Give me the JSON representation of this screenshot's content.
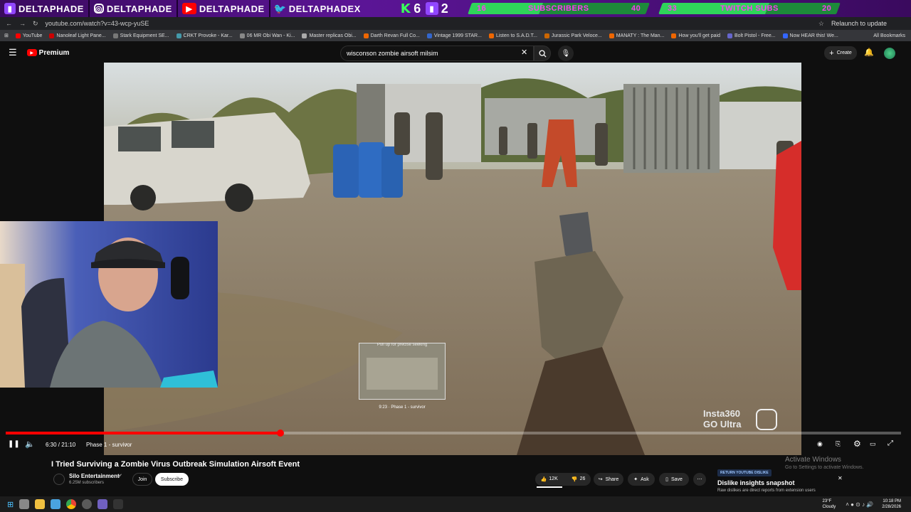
{
  "overlay": {
    "handles": [
      {
        "platform": "twitch",
        "name": "DELTAPHADE",
        "color": "#9146ff"
      },
      {
        "platform": "instagram",
        "name": "DELTAPHADE",
        "color": "#e1306c"
      },
      {
        "platform": "youtube",
        "name": "DELTAPHADE",
        "color": "#ff0000"
      },
      {
        "platform": "twitter",
        "name": "DELTAPHADEX",
        "color": "#1da1f2"
      }
    ],
    "counters": {
      "k_value": "6",
      "twitch_count": "2"
    },
    "subscribers": {
      "left": "16",
      "label": "SUBSCRIBERS",
      "right": "40",
      "progress": 0.4
    },
    "twitch_subs": {
      "left": "33",
      "label": "TWITCH SUBS",
      "right": "20",
      "progress": 0.6
    }
  },
  "browser": {
    "url": "youtube.com/watch?v=43-wcp-yuSE",
    "relaunch": "Relaunch to update",
    "all_bookmarks": "All Bookmarks",
    "bookmarks": [
      "YouTube",
      "Nanoleaf Light Pane...",
      "Stark Equipment SE...",
      "CRKT Provoke - Kar...",
      "06 MR Obi Wan - Ki...",
      "Master replicas Obi...",
      "Darth Revan Full Co...",
      "Vintage 1999 STAR...",
      "Listen to S.A.D.T...",
      "Jurassic Park Veloce...",
      "MANATY : The Man...",
      "How you'll get paid",
      "Bolt Pistol - Free...",
      "Now HEAR this! We..."
    ]
  },
  "youtube": {
    "logo": "Premium",
    "search_value": "wisconson zombie airsoft milsim",
    "create_label": "Create"
  },
  "player": {
    "time": "6:30 / 21:10",
    "chapter": "Phase 1 - survivor",
    "preview_hint": "Pull up for precise seeking",
    "preview_time": "9:23 · Phase 1 - survivor",
    "watermark_top": "Insta360",
    "watermark_bottom": "GO Ultra",
    "progress": 0.307
  },
  "video": {
    "title": "I Tried Surviving a Zombie Virus Outbreak Simulation Airsoft Event",
    "channel": "Silo Entertainment",
    "subscribers": "6.25M subscribers",
    "join": "Join",
    "subscribe": "Subscribe",
    "likes": "12K",
    "dislikes": "26",
    "share": "Share",
    "ask": "Ask",
    "save": "Save"
  },
  "activation": {
    "title": "Activate Windows",
    "subtitle": "Go to Settings to activate Windows."
  },
  "extension": {
    "badge": "RETURN YOUTUBE DISLIKE",
    "title": "Dislike insights snapshot",
    "body": "Raw dislikes are direct reports from extension users"
  },
  "taskbar": {
    "weather_temp": "23°F",
    "weather_desc": "Cloudy",
    "time": "10:18 PM",
    "date": "2/28/2026"
  }
}
